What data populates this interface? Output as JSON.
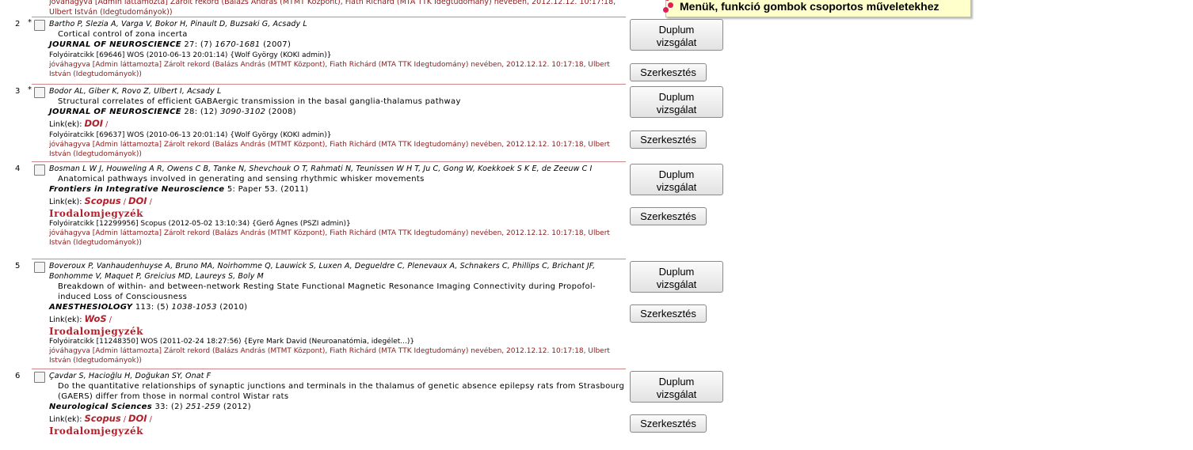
{
  "top_status": "jóváhagyva [Admin láttamozta] Zárolt rekord (Balázs András (MTMT Központ), Fiath Richárd (MTA TTK Idegtudomány) nevében, 2012.12.12. 10:17:18, Ulbert István (Idegtudományok))",
  "tooltip": {
    "text": "Menük, funkció gombok csoportos műveletekhez"
  },
  "buttons": {
    "duplicate_line1": "Duplum",
    "duplicate_line2": "vizsgálat",
    "edit": "Szerkesztés"
  },
  "records": [
    {
      "num": "2",
      "star": "*",
      "authors": "Bartho P, Slezia A, Varga V, Bokor H, Pinault D, Buzsaki G, Acsady L",
      "title": "Cortical control of zona incerta",
      "journal": {
        "name": "JOURNAL OF NEUROSCIENCE",
        "vol": "27",
        "issue": ": (7)",
        "pages": "1670-1681",
        "year": "(2007)"
      },
      "links": [],
      "biblio": "",
      "record_line": "Folyóiratcikk [69646] WOS (2010-06-13 20:01:14) {Wolf György (KOKI admin)}",
      "approved": "jóváhagyva [Admin láttamozta] Zárolt rekord (Balázs András (MTMT Központ), Fiath Richárd (MTA TTK Idegtudomány) nevében, 2012.12.12. 10:17:18, Ulbert István (Idegtudományok))"
    },
    {
      "num": "3",
      "star": "*",
      "authors": "Bodor AL, Giber K, Rovo Z, Ulbert I, Acsady L",
      "title": "Structural correlates of efficient GABAergic transmission in the basal ganglia-thalamus pathway",
      "journal": {
        "name": "JOURNAL OF NEUROSCIENCE",
        "vol": "28",
        "issue": ": (12)",
        "pages": "3090-3102",
        "year": "(2008)"
      },
      "links_label": "Link(ek):",
      "links": [
        "DOI"
      ],
      "biblio": "",
      "record_line": "Folyóiratcikk [69637] WOS (2010-06-13 20:01:14) {Wolf György (KOKI admin)}",
      "approved": "jóváhagyva [Admin láttamozta] Zárolt rekord (Balázs András (MTMT Központ), Fiath Richárd (MTA TTK Idegtudomány) nevében, 2012.12.12. 10:17:18, Ulbert István (Idegtudományok))"
    },
    {
      "num": "4",
      "star": "",
      "authors": "Bosman L W J, Houweling A R, Owens C B, Tanke N, Shevchouk O T, Rahmati N, Teunissen W H T, Ju C, Gong W, Koekkoek S K E, de Zeeuw C I",
      "title": "Anatomical pathways involved in generating and sensing rhythmic whisker movements",
      "journal": {
        "name": "Frontiers in Integrative Neuroscience",
        "vol": "5",
        "issue": ": Paper 53.",
        "pages": "",
        "year": "(2011)"
      },
      "links_label": "Link(ek):",
      "links": [
        "Scopus",
        "DOI"
      ],
      "biblio": "Irodalomjegyzék",
      "record_line": "Folyóiratcikk [12299956] Scopus (2012-05-02 13:10:34) {Gerő Ágnes (PSZI admin)}",
      "approved": "jóváhagyva [Admin láttamozta] Zárolt rekord (Balázs András (MTMT Központ), Fiath Richárd (MTA TTK Idegtudomány) nevében, 2012.12.12. 10:17:18, Ulbert István (Idegtudományok))"
    },
    {
      "num": "5",
      "star": "",
      "authors": "Boveroux P, Vanhaudenhuyse A, Bruno MA, Noirhomme Q, Lauwick S, Luxen A, Degueldre C, Plenevaux A, Schnakers C, Phillips C, Brichant JF, Bonhomme V, Maquet P, Greicius MD, Laureys S, Boly M",
      "title": "Breakdown of within- and between-network Resting State Functional Magnetic Resonance Imaging Connectivity during Propofol-induced Loss of Consciousness",
      "journal": {
        "name": "ANESTHESIOLOGY",
        "vol": "113",
        "issue": ": (5)",
        "pages": "1038-1053",
        "year": "(2010)"
      },
      "links_label": "Link(ek):",
      "links": [
        "WoS"
      ],
      "biblio": "Irodalomjegyzék",
      "record_line": "Folyóiratcikk [11248350] WOS (2011-02-24 18:27:56) {Eyre Mark David (Neuroanatómia, idegélet...)}",
      "approved": "jóváhagyva [Admin láttamozta] Zárolt rekord (Balázs András (MTMT Központ), Fiath Richárd (MTA TTK Idegtudomány) nevében, 2012.12.12. 10:17:18, Ulbert István (Idegtudományok))"
    },
    {
      "num": "6",
      "star": "",
      "authors": "Çavdar S, Hacioğlu H, Doğukan SY, Onat F",
      "title": "Do the quantitative relationships of synaptic junctions and terminals in the thalamus of genetic absence epilepsy rats from Strasbourg (GAERS) differ from those in normal control Wistar rats",
      "journal": {
        "name": "Neurological Sciences",
        "vol": "33",
        "issue": ": (2)",
        "pages": "251-259",
        "year": "(2012)"
      },
      "links_label": "Link(ek):",
      "links": [
        "Scopus",
        "DOI"
      ],
      "biblio": "Irodalomjegyzék",
      "record_line": "",
      "approved": ""
    }
  ]
}
